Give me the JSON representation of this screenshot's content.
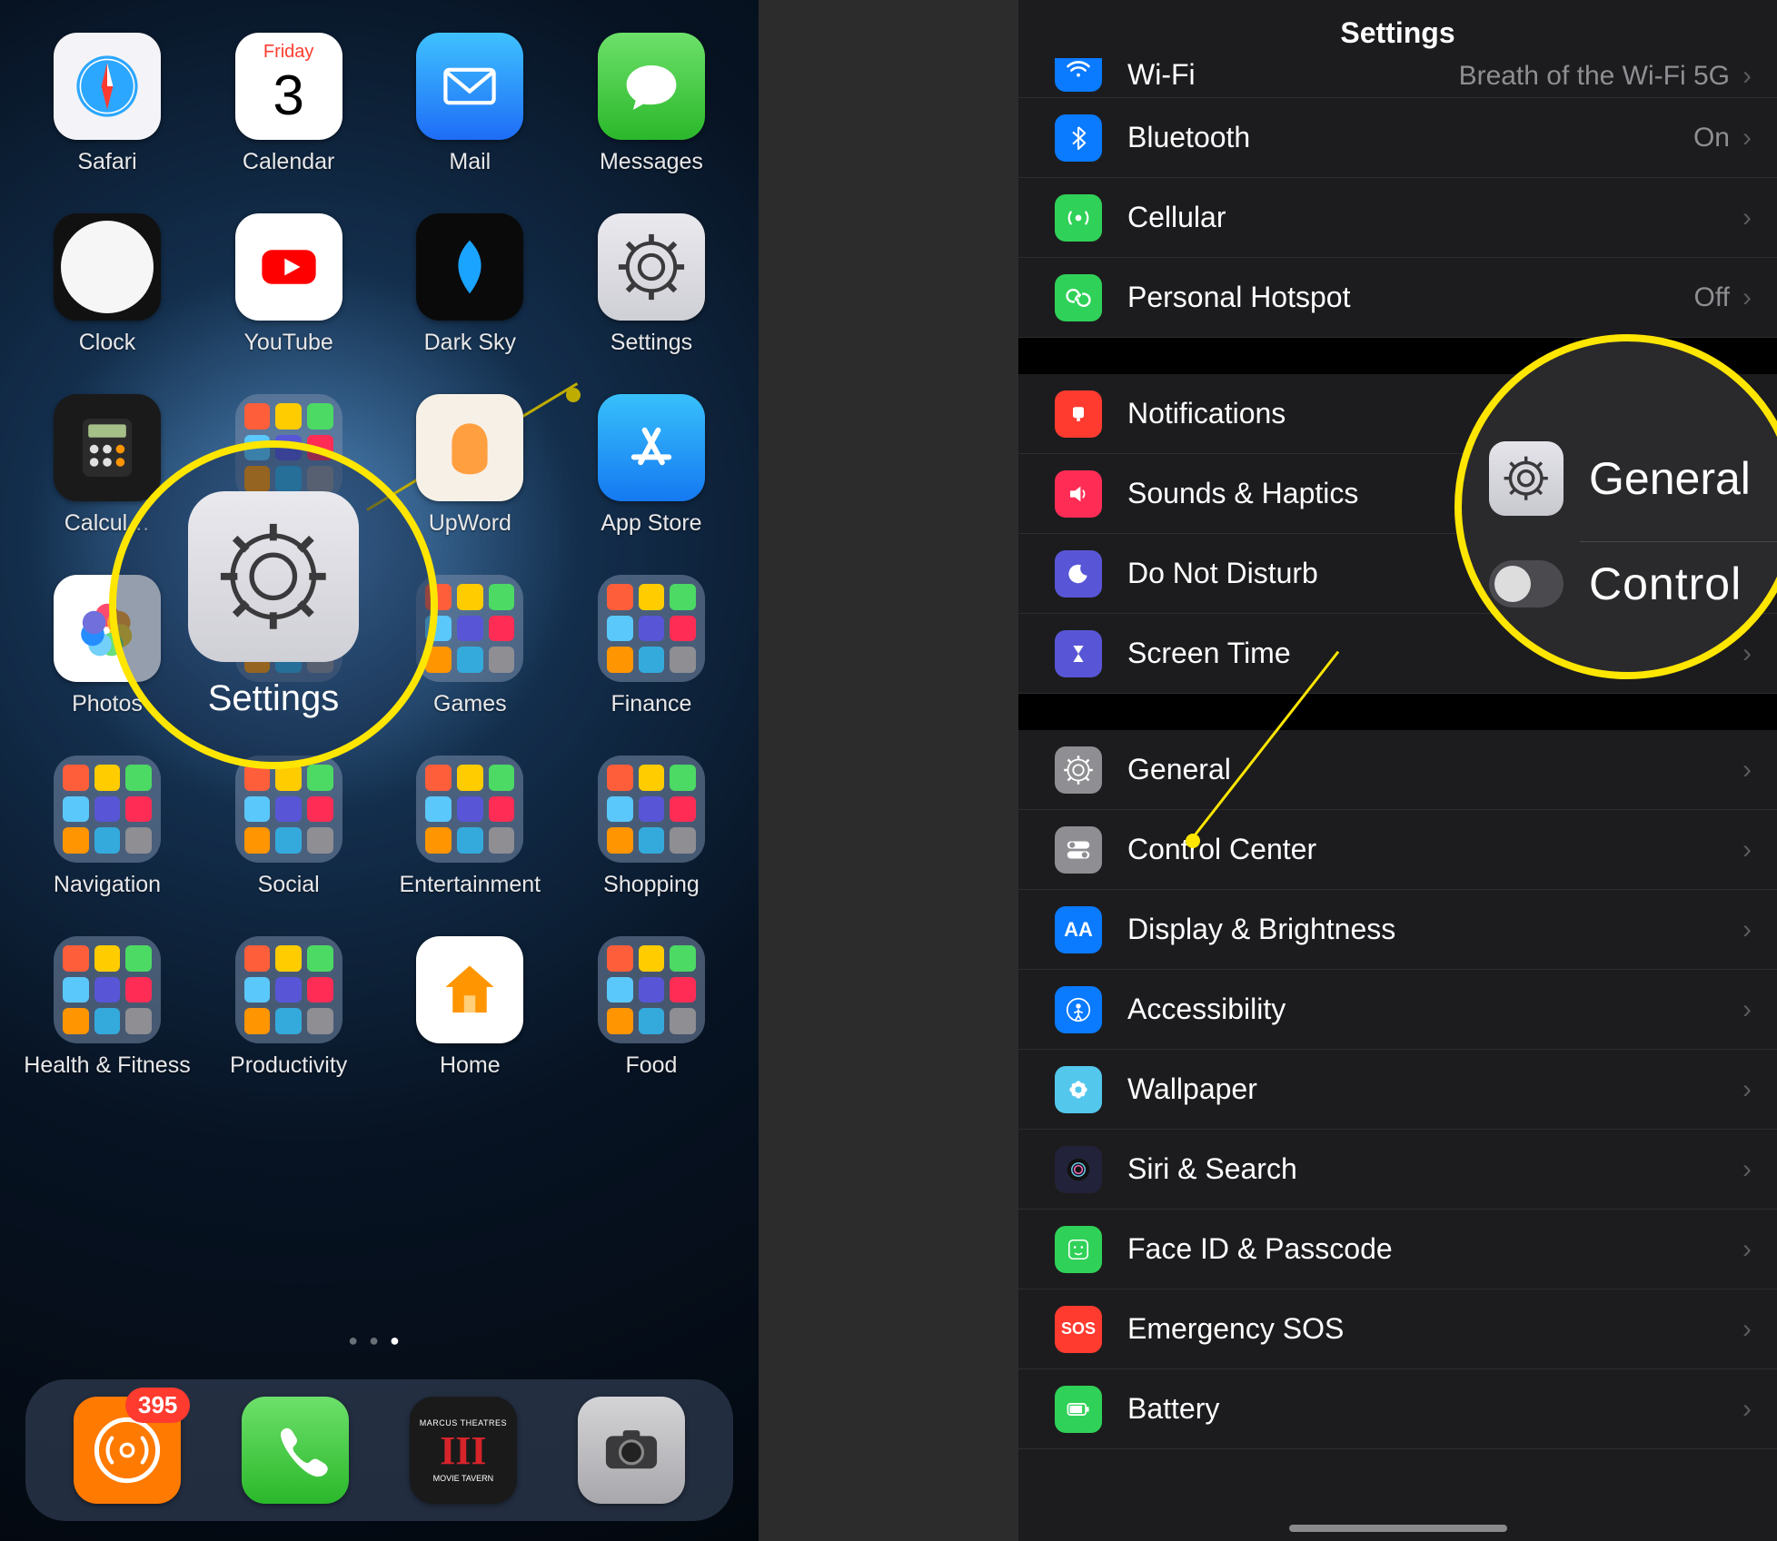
{
  "left": {
    "apps_rows": [
      [
        {
          "name": "safari",
          "label": "Safari",
          "bg": "#f4f4f8"
        },
        {
          "name": "calendar",
          "label": "Calendar",
          "bg": "#ffffff",
          "cal_day": "Friday",
          "cal_num": "3"
        },
        {
          "name": "mail",
          "label": "Mail",
          "bg": "linear-gradient(#3fc1ff,#1e6df6)"
        },
        {
          "name": "messages",
          "label": "Messages",
          "bg": "linear-gradient(#6de06a,#2bb82b)"
        }
      ],
      [
        {
          "name": "clock",
          "label": "Clock",
          "bg": "#111"
        },
        {
          "name": "youtube",
          "label": "YouTube",
          "bg": "#ffffff"
        },
        {
          "name": "darksky",
          "label": "Dark Sky",
          "bg": "#0a0a0a"
        },
        {
          "name": "settings",
          "label": "Settings",
          "bg": "linear-gradient(#e9e9ee,#cfcfd6)"
        }
      ],
      [
        {
          "name": "calculator",
          "label": "Calcul…",
          "bg": "#1a1a1a"
        },
        {
          "name": "folder",
          "label": "",
          "folder": true
        },
        {
          "name": "upword",
          "label": "UpWord",
          "bg": "#f7f0e6"
        },
        {
          "name": "appstore",
          "label": "App Store",
          "bg": "linear-gradient(#38c0fb,#1579f2)"
        }
      ],
      [
        {
          "name": "photos",
          "label": "Photos",
          "bg": "#ffffff"
        },
        {
          "name": "folder2",
          "label": "",
          "folder": true
        },
        {
          "name": "games",
          "label": "Games",
          "folder": true
        },
        {
          "name": "finance",
          "label": "Finance",
          "folder": true
        }
      ],
      [
        {
          "name": "navigation",
          "label": "Navigation",
          "folder": true
        },
        {
          "name": "social",
          "label": "Social",
          "folder": true
        },
        {
          "name": "entertainment",
          "label": "Entertainment",
          "folder": true
        },
        {
          "name": "shopping",
          "label": "Shopping",
          "folder": true
        }
      ],
      [
        {
          "name": "health",
          "label": "Health & Fitness",
          "folder": true
        },
        {
          "name": "productivity",
          "label": "Productivity",
          "folder": true
        },
        {
          "name": "home",
          "label": "Home",
          "bg": "#ffffff"
        },
        {
          "name": "food",
          "label": "Food",
          "folder": true
        }
      ]
    ],
    "dock": [
      {
        "name": "overcast",
        "bg": "#ff7a00",
        "badge": "395"
      },
      {
        "name": "phone",
        "bg": "linear-gradient(#6de06a,#2bb82b)"
      },
      {
        "name": "movietavern",
        "bg": "#1a1a1a",
        "text_top": "MARCUS THEATRES",
        "text_bot": "MOVIE TAVERN"
      },
      {
        "name": "camera",
        "bg": "linear-gradient(#d4d4d7,#a8a8ac)"
      }
    ],
    "highlight_label": "Settings"
  },
  "right": {
    "title": "Settings",
    "rows_top_cut": {
      "label": "Wi-Fi",
      "detail": "Breath of the Wi-Fi 5G",
      "icon_bg": "#0a7aff"
    },
    "group1": [
      {
        "name": "bluetooth",
        "label": "Bluetooth",
        "detail": "On",
        "icon_bg": "#0a7aff",
        "glyph": "bt"
      },
      {
        "name": "cellular",
        "label": "Cellular",
        "detail": "",
        "icon_bg": "#30d158",
        "glyph": "antenna"
      },
      {
        "name": "hotspot",
        "label": "Personal Hotspot",
        "detail": "Off",
        "icon_bg": "#30d158",
        "glyph": "link"
      }
    ],
    "group2": [
      {
        "name": "notifications",
        "label": "Notifications",
        "icon_bg": "#ff3b30",
        "glyph": "bell"
      },
      {
        "name": "sounds",
        "label": "Sounds & Haptics",
        "icon_bg": "#ff2d55",
        "glyph": "speaker"
      },
      {
        "name": "dnd",
        "label": "Do Not Disturb",
        "icon_bg": "#5856d6",
        "glyph": "moon"
      },
      {
        "name": "screentime",
        "label": "Screen Time",
        "icon_bg": "#5856d6",
        "glyph": "hourglass"
      }
    ],
    "group3": [
      {
        "name": "general",
        "label": "General",
        "icon_bg": "#8e8e93",
        "glyph": "gear"
      },
      {
        "name": "controlcenter",
        "label": "Control Center",
        "icon_bg": "#8e8e93",
        "glyph": "switches"
      },
      {
        "name": "display",
        "label": "Display & Brightness",
        "icon_bg": "#0a7aff",
        "glyph": "AA"
      },
      {
        "name": "accessibility",
        "label": "Accessibility",
        "icon_bg": "#0a7aff",
        "glyph": "person"
      },
      {
        "name": "wallpaper",
        "label": "Wallpaper",
        "icon_bg": "#54c7ec",
        "glyph": "flower"
      },
      {
        "name": "siri",
        "label": "Siri & Search",
        "icon_bg": "#22223a",
        "glyph": "siri"
      },
      {
        "name": "faceid",
        "label": "Face ID & Passcode",
        "icon_bg": "#30d158",
        "glyph": "face"
      },
      {
        "name": "sos",
        "label": "Emergency SOS",
        "icon_bg": "#ff3b30",
        "glyph": "SOS"
      },
      {
        "name": "battery",
        "label": "Battery",
        "icon_bg": "#30d158",
        "glyph": "battery"
      }
    ],
    "highlight": {
      "row1": "General",
      "row2": "Control"
    }
  }
}
